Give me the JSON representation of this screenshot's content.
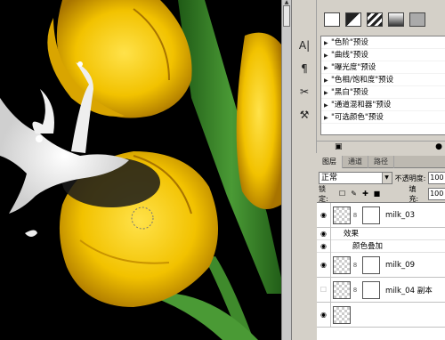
{
  "action_list": {
    "items": [
      "\"色阶\"预设",
      "\"曲线\"预设",
      "\"曝光度\"预设",
      "\"色相/饱和度\"预设",
      "\"黑白\"预设",
      "\"通道混和器\"预设",
      "\"可选颜色\"预设"
    ]
  },
  "layers_panel": {
    "tabs": [
      "图层",
      "通道",
      "路径"
    ],
    "blend_mode": "正常",
    "opacity_label": "不透明度:",
    "opacity_value": "100",
    "lock_label": "锁定:",
    "fill_label": "填充:",
    "fill_value": "100",
    "layers": [
      {
        "name": "milk_03"
      },
      {
        "effects_label": "效果"
      },
      {
        "effect_name": "颜色叠加"
      },
      {
        "name": "milk_09"
      },
      {
        "name": "milk_04 副本"
      }
    ]
  },
  "colors": {
    "panel_bg": "#d4d0c8",
    "tulip_yellow": "#f2c200",
    "stem_green": "#3f8a2c"
  }
}
